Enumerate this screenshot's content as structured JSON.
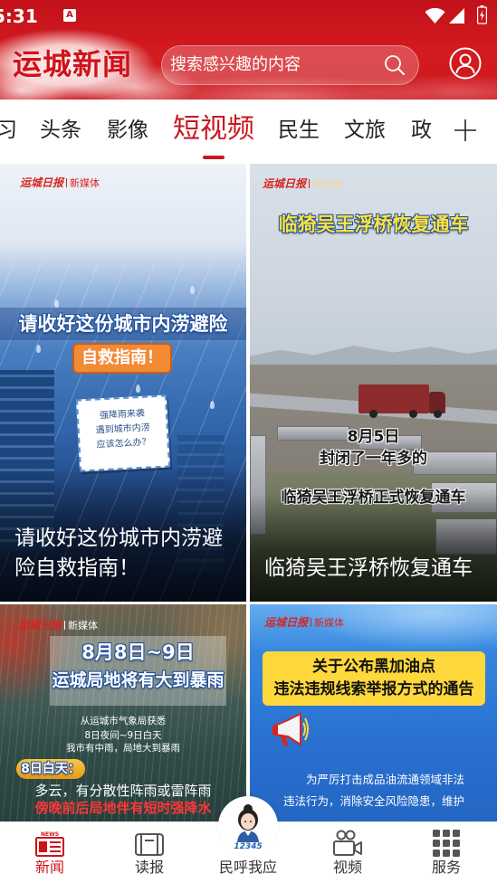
{
  "status_bar": {
    "time": "5:31",
    "notification_badge": "A",
    "icons": [
      "wifi-icon",
      "signal-icon",
      "battery-icon"
    ]
  },
  "header": {
    "logo_text": "运城新闻",
    "search_placeholder": "搜索感兴趣的内容",
    "search_icon": "search-icon",
    "user_icon": "user-icon"
  },
  "tabs": {
    "items": [
      {
        "label": "习",
        "active": false
      },
      {
        "label": "头条",
        "active": false
      },
      {
        "label": "影像",
        "active": false
      },
      {
        "label": "短视频",
        "active": true
      },
      {
        "label": "民生",
        "active": false
      },
      {
        "label": "文旅",
        "active": false
      },
      {
        "label": "政",
        "active": false
      }
    ],
    "add_icon": "plus-icon"
  },
  "cards": [
    {
      "brand": "运城日报",
      "brand_sub": "新媒体",
      "cover_title": "请收好这份城市内涝避险",
      "cover_badge": "自救指南！",
      "note_lines": [
        "强降雨来袭",
        "遇到城市内涝",
        "应该怎么办？"
      ],
      "caption": "请收好这份城市内涝避险自救指南！"
    },
    {
      "brand": "运城日报",
      "brand_sub": "新媒体",
      "cover_title": "临猗吴王浮桥恢复通车",
      "cover_lines": [
        "8月5日",
        "封闭了一年多的",
        "临猗吴王浮桥正式恢复通车"
      ],
      "caption": "临猗吴王浮桥恢复通车"
    },
    {
      "brand": "运城日报",
      "brand_sub": "新媒体",
      "cover_title": "8月8日~9日",
      "cover_subtitle": "运城局地将有大到暴雨",
      "source": "从运城市气象局获悉",
      "forecast_lines": [
        "8日夜间~9日白天",
        "我市有中雨，局地大到暴雨"
      ],
      "day_label": "8日白天：",
      "day_lines": [
        "多云，有分散性阵雨或雷阵雨",
        "傍晚前后局地伴有短时强降水"
      ]
    },
    {
      "brand": "运城日报",
      "brand_sub": "新媒体",
      "cover_title_lines": [
        "关于公布黑加油点",
        "违法违规线索举报方式的通告"
      ],
      "body_lines": [
        "为严厉打击成品油流通领域非法",
        "违法行为，消除安全风险隐患，维护"
      ],
      "icon": "megaphone-icon"
    }
  ],
  "bottom_nav": {
    "items": [
      {
        "label": "新闻",
        "icon": "news-icon",
        "icon_text": "NEWS",
        "active": true
      },
      {
        "label": "读报",
        "icon": "newspaper-icon",
        "active": false
      },
      {
        "label": "民呼我应",
        "icon": "hotline-avatar-icon",
        "icon_text": "12345",
        "active": false
      },
      {
        "label": "视频",
        "icon": "video-icon",
        "active": false
      },
      {
        "label": "服务",
        "icon": "services-grid-icon",
        "active": false
      }
    ]
  },
  "colors": {
    "brand_red": "#c8161d",
    "active_tab": "#c9171e",
    "nav_active": "#d0121b",
    "nav_inactive": "#333333"
  }
}
